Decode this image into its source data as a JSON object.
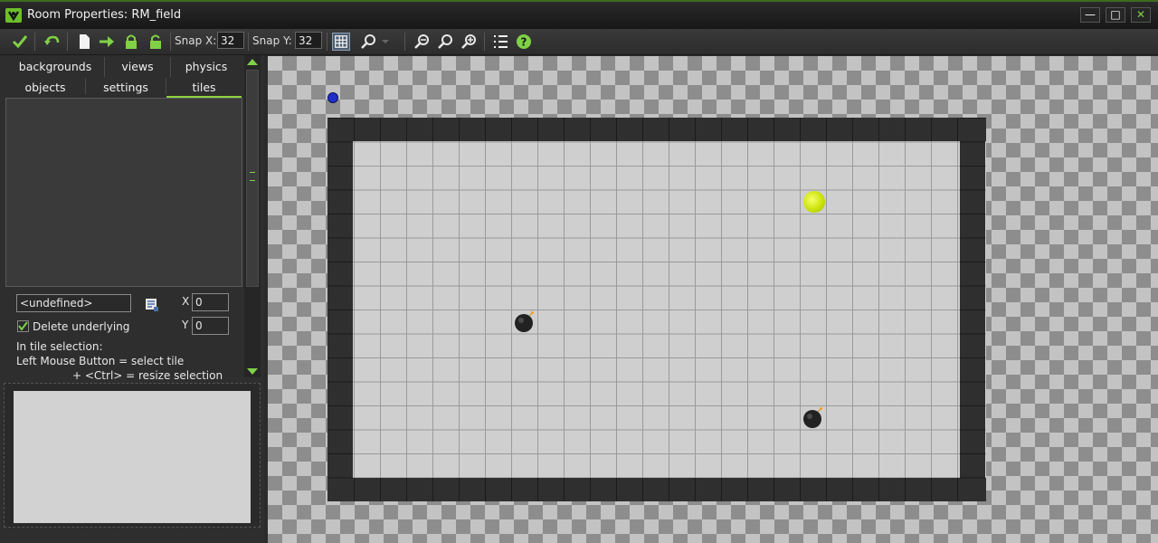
{
  "window": {
    "title": "Room Properties: RM_field",
    "minimize_icon": "minimize-icon",
    "maximize_icon": "maximize-icon",
    "close_icon": "close-icon"
  },
  "toolbar": {
    "snap_x_label": "Snap X:",
    "snap_x_value": "32",
    "snap_y_label": "Snap Y:",
    "snap_y_value": "32",
    "icons": [
      "ok-checkmark-icon",
      "undo-icon",
      "new-document-icon",
      "shift-arrow-icon",
      "lock-icon",
      "unlock-icon",
      "grid-toggle-icon",
      "magnifier-dropdown-icon",
      "zoom-out-icon",
      "zoom-reset-icon",
      "zoom-in-icon",
      "list-settings-icon",
      "help-icon"
    ]
  },
  "panel": {
    "tabs_row1": [
      "backgrounds",
      "views",
      "physics"
    ],
    "tabs_row2": [
      "objects",
      "settings",
      "tiles"
    ],
    "active_tab": "tiles",
    "background_select_value": "<undefined>",
    "x_label": "X",
    "x_value": "0",
    "y_label": "Y",
    "y_value": "0",
    "delete_underlying_label": "Delete underlying",
    "delete_underlying_checked": true,
    "help_line1": "In tile selection:",
    "help_line2": "Left Mouse Button  = select tile",
    "help_line3": "+ <Ctrl> = resize selection"
  },
  "room": {
    "name": "RM_field",
    "instances": [
      "view-origin-marker",
      "yellow-ball",
      "bomb",
      "bomb"
    ]
  }
}
